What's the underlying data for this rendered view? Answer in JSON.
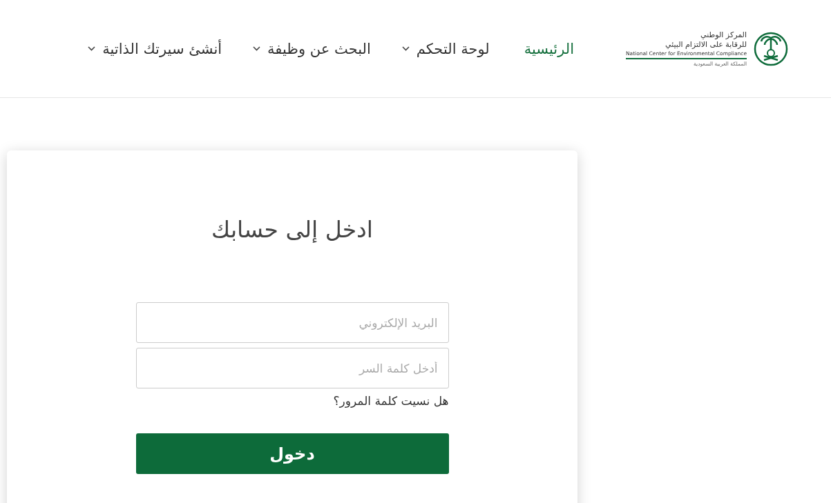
{
  "logo": {
    "name_ar_line1": "المركز الوطني",
    "name_ar_line2": "للرقابة على الالتزام البيئي",
    "name_en": "National Center for Environmental Compliance",
    "country": "المملكة العربية السعودية"
  },
  "nav": [
    {
      "label": "الرئيسية",
      "selected": true,
      "dropdown": false
    },
    {
      "label": "لوحة التحكم",
      "selected": false,
      "dropdown": true
    },
    {
      "label": "البحث عن وظيفة",
      "selected": false,
      "dropdown": true
    },
    {
      "label": "أنشئ سيرتك الذاتية",
      "selected": false,
      "dropdown": true
    }
  ],
  "login": {
    "title": "ادخل إلى حسابك",
    "email": {
      "placeholder": "البريد الإلكتروني"
    },
    "password": {
      "placeholder": "أدخل كلمة السر"
    },
    "forgot_link": "هل نسيت كلمة المرور؟",
    "submit": "دخول"
  }
}
